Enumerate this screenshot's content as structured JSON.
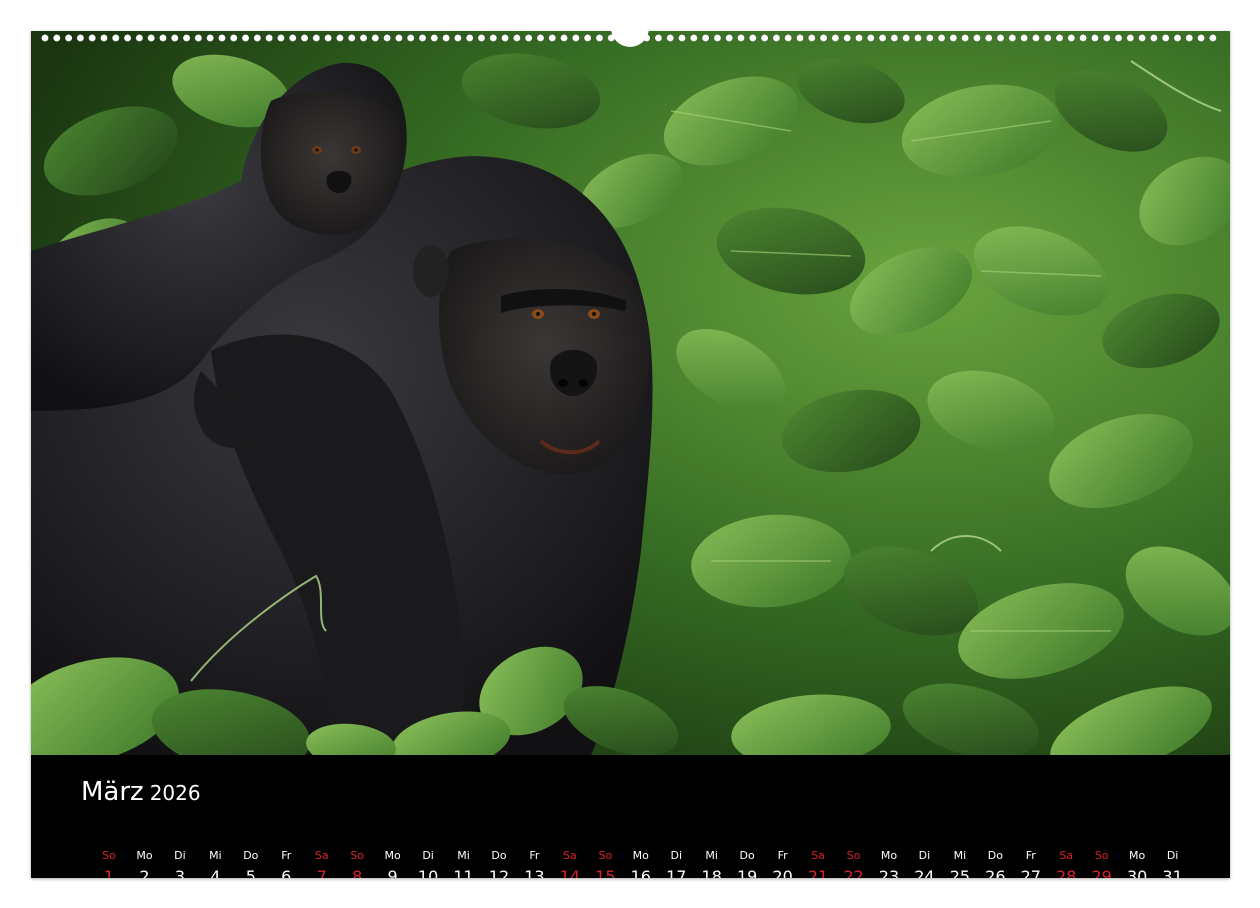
{
  "calendar": {
    "month": "März",
    "year": "2026",
    "weekend_color": "#d8232a",
    "text_color": "#ffffff",
    "days": [
      {
        "wd": "So",
        "d": "1",
        "we": true
      },
      {
        "wd": "Mo",
        "d": "2",
        "we": false
      },
      {
        "wd": "Di",
        "d": "3",
        "we": false
      },
      {
        "wd": "Mi",
        "d": "4",
        "we": false
      },
      {
        "wd": "Do",
        "d": "5",
        "we": false
      },
      {
        "wd": "Fr",
        "d": "6",
        "we": false
      },
      {
        "wd": "Sa",
        "d": "7",
        "we": true
      },
      {
        "wd": "So",
        "d": "8",
        "we": true
      },
      {
        "wd": "Mo",
        "d": "9",
        "we": false
      },
      {
        "wd": "Di",
        "d": "10",
        "we": false
      },
      {
        "wd": "Mi",
        "d": "11",
        "we": false
      },
      {
        "wd": "Do",
        "d": "12",
        "we": false
      },
      {
        "wd": "Fr",
        "d": "13",
        "we": false
      },
      {
        "wd": "Sa",
        "d": "14",
        "we": true
      },
      {
        "wd": "So",
        "d": "15",
        "we": true
      },
      {
        "wd": "Mo",
        "d": "16",
        "we": false
      },
      {
        "wd": "Di",
        "d": "17",
        "we": false
      },
      {
        "wd": "Mi",
        "d": "18",
        "we": false
      },
      {
        "wd": "Do",
        "d": "19",
        "we": false
      },
      {
        "wd": "Fr",
        "d": "20",
        "we": false
      },
      {
        "wd": "Sa",
        "d": "21",
        "we": true
      },
      {
        "wd": "So",
        "d": "22",
        "we": true
      },
      {
        "wd": "Mo",
        "d": "23",
        "we": false
      },
      {
        "wd": "Di",
        "d": "24",
        "we": false
      },
      {
        "wd": "Mi",
        "d": "25",
        "we": false
      },
      {
        "wd": "Do",
        "d": "26",
        "we": false
      },
      {
        "wd": "Fr",
        "d": "27",
        "we": false
      },
      {
        "wd": "Sa",
        "d": "28",
        "we": true
      },
      {
        "wd": "So",
        "d": "29",
        "we": true
      },
      {
        "wd": "Mo",
        "d": "30",
        "we": false
      },
      {
        "wd": "Di",
        "d": "31",
        "we": false
      }
    ]
  },
  "photo": {
    "subject": "gorilla-with-baby-in-foliage",
    "palette": {
      "foliage_dark": "#1f3d14",
      "foliage_mid": "#3f7a2a",
      "foliage_light": "#7fb04e",
      "fur": "#1c1c1e",
      "fur_highlight": "#3a3a3e",
      "eye": "#8a4a1a"
    }
  }
}
